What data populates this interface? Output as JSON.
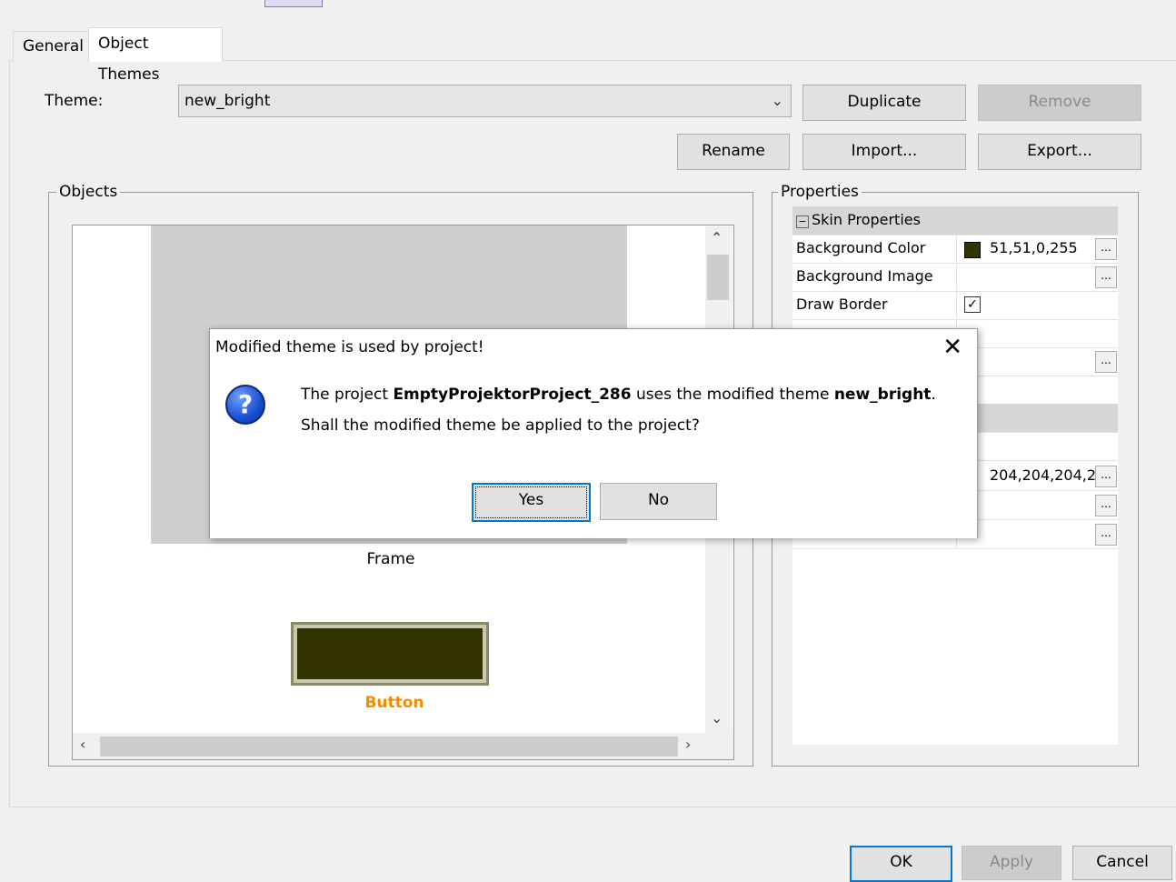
{
  "tabs": [
    {
      "label": "General"
    },
    {
      "label": "Object Themes"
    }
  ],
  "theme": {
    "label": "Theme:",
    "selected": "new_bright",
    "buttons": {
      "duplicate": "Duplicate",
      "remove": "Remove",
      "rename": "Rename",
      "import": "Import...",
      "export": "Export..."
    }
  },
  "objects": {
    "title": "Objects",
    "frame_label": "Frame",
    "button_label": "Button",
    "button_label_color": "#f28c00",
    "button_fill_color": "#333300"
  },
  "properties": {
    "title": "Properties",
    "section": "Skin Properties",
    "rows": [
      {
        "name": "Background Color",
        "value": "51,51,0,255"
      },
      {
        "name": "Background Image",
        "value": ""
      },
      {
        "name": "Draw Border",
        "value": ""
      }
    ],
    "partial_value": "204,204,204,2"
  },
  "dialog": {
    "title": "Modified theme is used by project!",
    "message_prefix": "The project ",
    "project_name": "EmptyProjektorProject_286",
    "message_middle": " uses the modified theme ",
    "theme_name": "new_bright",
    "message_suffix": ".",
    "question": "Shall the modified theme be applied to the project?",
    "yes": "Yes",
    "no": "No"
  },
  "footer": {
    "ok": "OK",
    "apply": "Apply",
    "cancel": "Cancel"
  }
}
